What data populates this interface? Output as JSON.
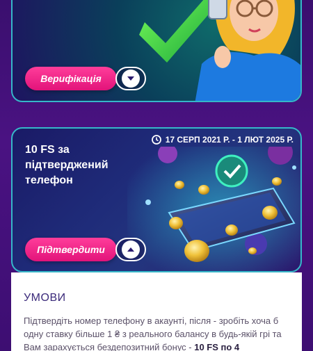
{
  "verification_card": {
    "button_label": "Верифікація",
    "toggle_icon": "chevron-down-icon"
  },
  "phone_card": {
    "date_range": "17 СЕРП 2021 Р. - 1 ЛЮТ 2025 Р.",
    "date_icon": "clock-icon",
    "title": "10 FS за підтверджений телефон",
    "button_label": "Підтвердити",
    "toggle_icon": "chevron-up-icon"
  },
  "conditions": {
    "heading": "УМОВИ",
    "text_part1": "Підтвердіть номер телефону в акаунті, після - зробіть хоча б одну ставку більше 1 ₴ з реального балансу в будь-якій грі та Вам зарахується бездепозитний бонус - ",
    "text_bold": "10 FS по 4"
  },
  "colors": {
    "accent_pink": "#e2137a",
    "border_teal": "#36b7c9",
    "background_purple": "#3a0f6e"
  }
}
